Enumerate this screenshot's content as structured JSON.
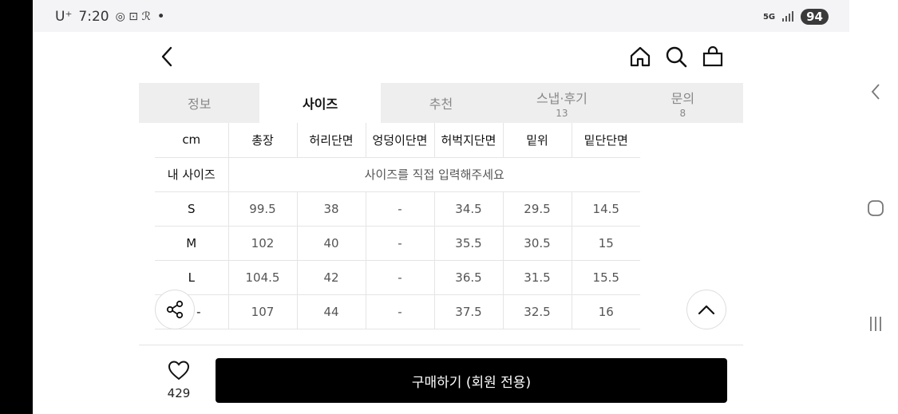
{
  "status_bar": {
    "carrier": "U⁺",
    "time": "7:20",
    "extra": "•",
    "network": "5G",
    "battery": "94"
  },
  "header": {
    "back_icon": "chevron-left-icon",
    "home_icon": "home-icon",
    "search_icon": "search-icon",
    "bag_icon": "shopping-bag-icon"
  },
  "tabs": [
    {
      "label": "정보",
      "count": ""
    },
    {
      "label": "사이즈",
      "count": ""
    },
    {
      "label": "추천",
      "count": ""
    },
    {
      "label": "스냅·후기",
      "count": "13"
    },
    {
      "label": "문의",
      "count": "8"
    }
  ],
  "size_table": {
    "headers": [
      "cm",
      "총장",
      "허리단면",
      "엉덩이단면",
      "허벅지단면",
      "밑위",
      "밑단단면"
    ],
    "my_size_label": "내 사이즈",
    "my_size_prompt": "사이즈를 직접 입력해주세요",
    "rows": [
      {
        "size": "S",
        "values": [
          "99.5",
          "38",
          "-",
          "34.5",
          "29.5",
          "14.5"
        ]
      },
      {
        "size": "M",
        "values": [
          "102",
          "40",
          "-",
          "35.5",
          "30.5",
          "15"
        ]
      },
      {
        "size": "L",
        "values": [
          "104.5",
          "42",
          "-",
          "36.5",
          "31.5",
          "15.5"
        ]
      },
      {
        "size": "-",
        "values": [
          "107",
          "44",
          "-",
          "37.5",
          "32.5",
          "16"
        ]
      }
    ]
  },
  "bottom_bar": {
    "like_count": "429",
    "buy_label": "구매하기 (회원 전용)"
  }
}
